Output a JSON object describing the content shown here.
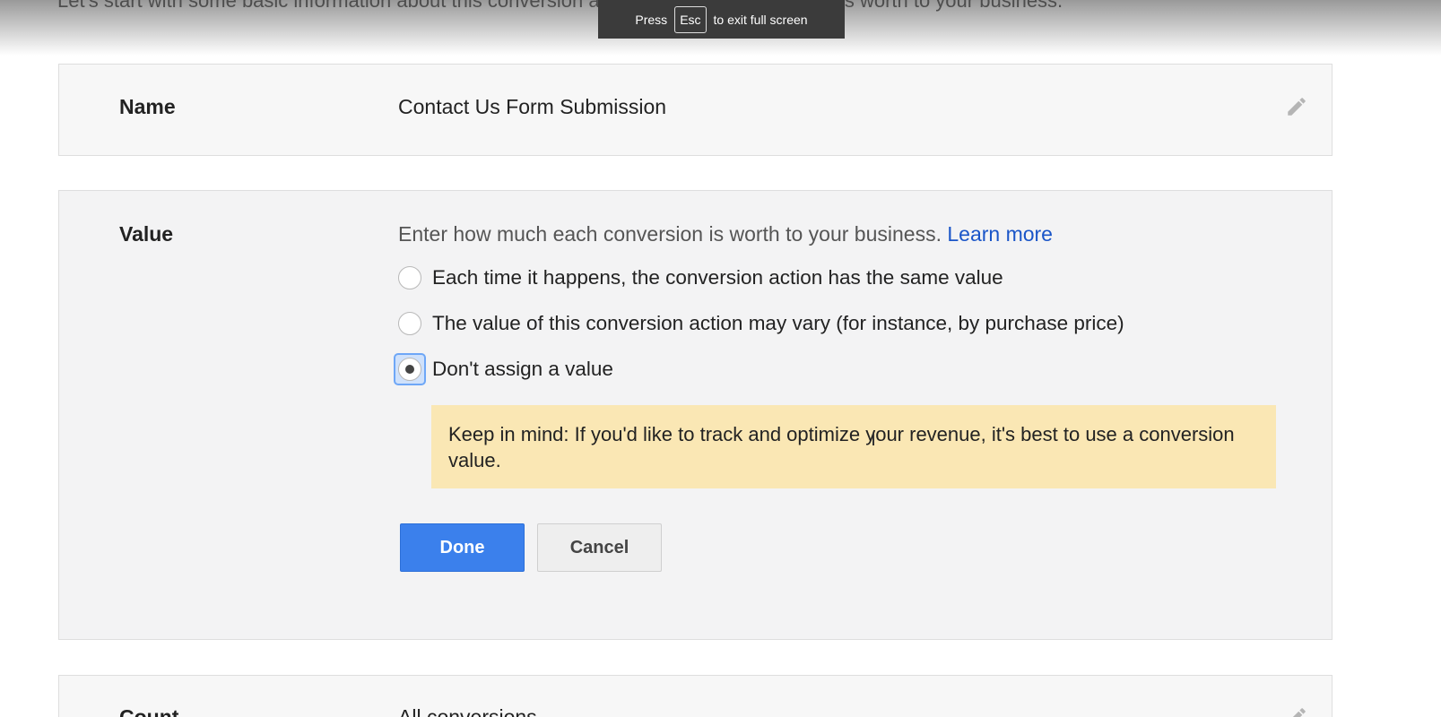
{
  "intro_text": "Let's start with some basic information about this conversion action, including how much it's worth to your business.",
  "fullscreen_notice": {
    "press": "Press",
    "key": "Esc",
    "rest": "to exit full screen"
  },
  "name_section": {
    "label": "Name",
    "value": "Contact Us Form Submission",
    "edit_icon": "pencil-icon"
  },
  "value_section": {
    "label": "Value",
    "description": "Enter how much each conversion is worth to your business.",
    "learn_more": "Learn more",
    "options": [
      {
        "label": "Each time it happens, the conversion action has the same value",
        "selected": false
      },
      {
        "label": "The value of this conversion action may vary (for instance, by purchase price)",
        "selected": false
      },
      {
        "label": "Don't assign a value",
        "selected": true
      }
    ],
    "notice": "Keep in mind: If you'd like to track and optimize your revenue, it's best to use a conversion value.",
    "done_label": "Done",
    "cancel_label": "Cancel"
  },
  "count_section": {
    "label": "Count",
    "value": "All conversions",
    "edit_icon": "pencil-icon"
  },
  "colors": {
    "primary_button": "#3b80ec",
    "link": "#1a55c8",
    "notice_background": "#fae7b4"
  }
}
